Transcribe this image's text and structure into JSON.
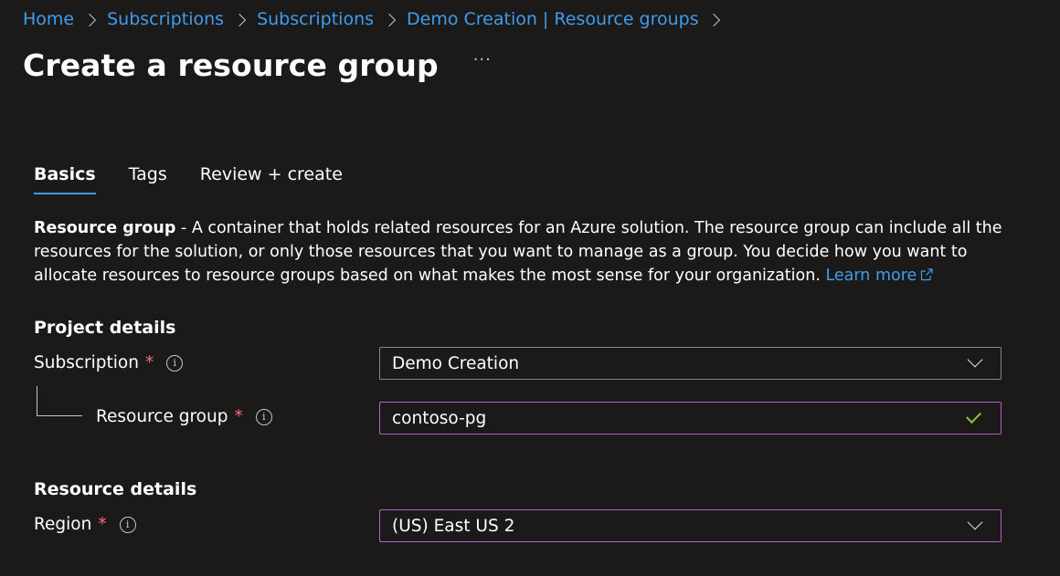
{
  "breadcrumb": {
    "items": [
      "Home",
      "Subscriptions",
      "Subscriptions",
      "Demo Creation | Resource groups"
    ]
  },
  "page": {
    "title": "Create a resource group",
    "more_label": "···"
  },
  "tabs": [
    {
      "label": "Basics",
      "active": true
    },
    {
      "label": "Tags",
      "active": false
    },
    {
      "label": "Review + create",
      "active": false
    }
  ],
  "description": {
    "term": "Resource group",
    "text": " - A container that holds related resources for an Azure solution. The resource group can include all the resources for the solution, or only those resources that you want to manage as a group. You decide how you want to allocate resources to resource groups based on what makes the most sense for your organization. ",
    "learn_more": "Learn more"
  },
  "project_details": {
    "title": "Project details",
    "subscription": {
      "label": "Subscription",
      "required": "*",
      "value": "Demo Creation"
    },
    "resource_group": {
      "label": "Resource group",
      "required": "*",
      "value": "contoso-pg",
      "valid": true
    }
  },
  "resource_details": {
    "title": "Resource details",
    "region": {
      "label": "Region",
      "required": "*",
      "value": "(US) East US 2"
    }
  },
  "colors": {
    "background": "#1b1a19",
    "link": "#3f9cf0",
    "required": "#f1707b",
    "focus_border": "#b55fd0",
    "valid_check": "#8cc63f"
  }
}
